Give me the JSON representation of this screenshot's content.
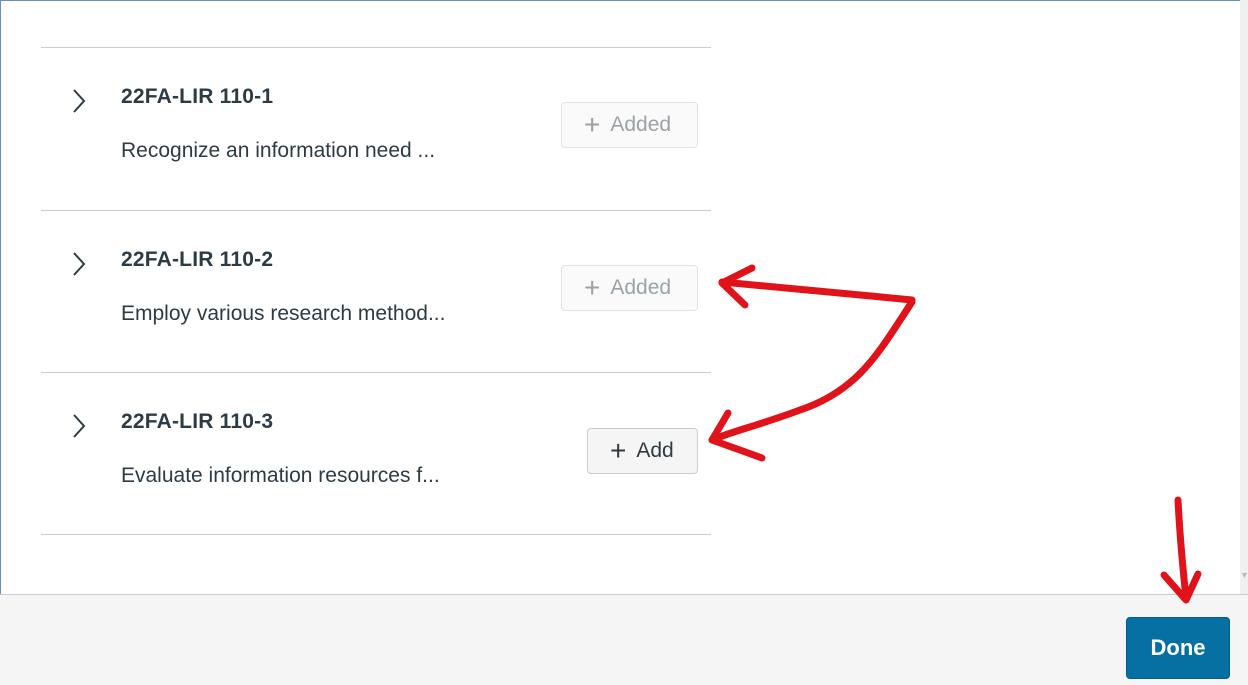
{
  "outcomes": [
    {
      "title": "22FA-LIR 110-1",
      "description": "Recognize an information need ...",
      "button_label": "Added",
      "button_state": "added"
    },
    {
      "title": "22FA-LIR 110-2",
      "description": "Employ various research method...",
      "button_label": "Added",
      "button_state": "added"
    },
    {
      "title": "22FA-LIR 110-3",
      "description": "Evaluate information resources f...",
      "button_label": "Add",
      "button_state": "add"
    }
  ],
  "icons": {
    "expand": "chevron-right-icon",
    "add": "plus-icon"
  },
  "footer": {
    "done_label": "Done"
  },
  "colors": {
    "primary": "#0770a3",
    "annotation": "#e0121a",
    "text": "#2d3b45",
    "disabled_text": "#9aa2a8"
  }
}
